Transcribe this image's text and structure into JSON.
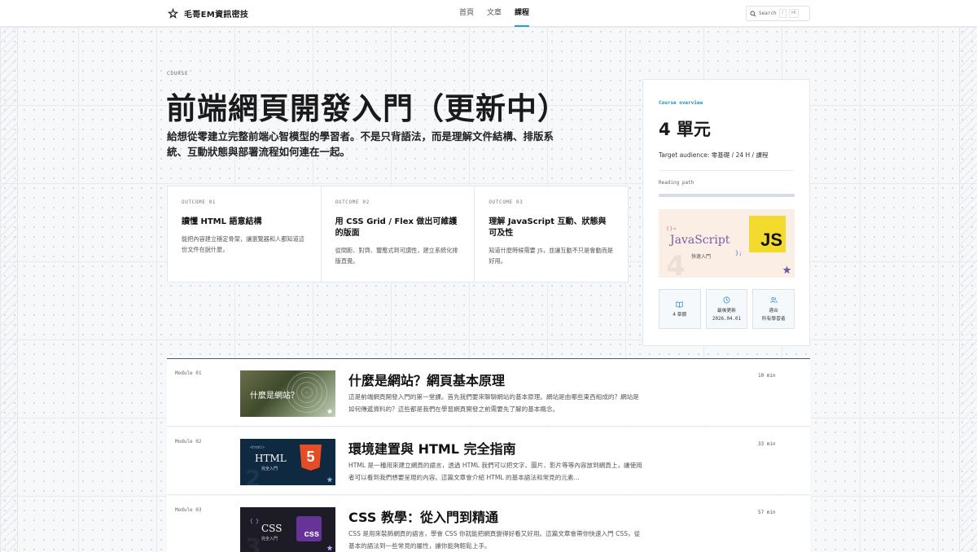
{
  "header": {
    "logo_text": "毛哥EM資訊密技",
    "nav": [
      {
        "label": "首頁",
        "active": false
      },
      {
        "label": "文章",
        "active": false
      },
      {
        "label": "課程",
        "active": true
      }
    ],
    "search_label": "Search",
    "search_kbd_1": "/",
    "search_kbd_2": "⌘K"
  },
  "hero": {
    "eyebrow": "COURSE",
    "title": "前端網頁開發入門（更新中）",
    "lead": "給想從零建立完整前端心智模型的學習者。不是只背語法，而是理解文件結構、排版系統、互動狀態與部署流程如何連在一起。",
    "outcomes": [
      {
        "label": "OUTCOME 01",
        "title": "讀懂 HTML 語意結構",
        "desc": "能把內容建立穩定骨架，讓瀏覽器和人都知道這份文件在說什麼。"
      },
      {
        "label": "OUTCOME 02",
        "title": "用 CSS Grid / Flex 做出可維護的版面",
        "desc": "從間距、對齊、響應式到可讀性，建立系統化排版直覺。"
      },
      {
        "label": "OUTCOME 03",
        "title": "理解 JavaScript 互動、狀態與可及性",
        "desc": "知道什麼時候需要 JS，並讓互動不只是會動而是好用。"
      }
    ]
  },
  "overview": {
    "eyebrow": "Course overview",
    "units": "4 單元",
    "audience": "Target audience: 零基礎 / 24 H / 課程",
    "reading_path": "Reading path",
    "thumb": {
      "code": "()⇒",
      "name": "JavaScript",
      "sub": "快速入門",
      "semi": "};",
      "num": "4",
      "logo": "JS"
    },
    "stats": [
      {
        "icon": "book-icon",
        "line1": "4 章節",
        "line2": ""
      },
      {
        "icon": "clock-icon",
        "line1": "最後更新",
        "line2": "2026.04.01"
      },
      {
        "icon": "users-icon",
        "line1": "適合",
        "line2": "所有學習者"
      }
    ]
  },
  "modules": [
    {
      "label": "Module 01",
      "title": "什麼是網站？網頁基本原理",
      "desc": "這是前端網頁開發入門的第一堂課。首先我們要來聊聊網站的基本原理。網站是由哪些東西組成的？網站是如何傳遞資料的？這些都是我們在學習網頁開發之前需要先了解的基本概念。",
      "time": "10 min",
      "thumb_caption": "什麼是網站？"
    },
    {
      "label": "Module 02",
      "title": "環境建置與 HTML 完全指南",
      "desc": "HTML 是一種用來建立網頁的語言，透過 HTML 我們可以把文字、圖片、影片等等內容放到網頁上，讓使用者可以看到我們想要呈現的內容。這篇文章會介紹 HTML 的基本語法和常見的元素...",
      "time": "33 min",
      "thumb_caption": "HTML",
      "thumb_sub": "完全入門",
      "thumb_code": "<html>",
      "thumb_num": "2",
      "thumb_logo": "5"
    },
    {
      "label": "Module 03",
      "title": "CSS 教學：從入門到精通",
      "desc": "CSS 是用來裝飾網頁的語言，學會 CSS 你就能把網頁變得好看又好用。這篇文章會帶你快速入門 CSS，從基本的語法到一些常見的屬性，讓你能夠輕鬆上手。",
      "time": "57 min",
      "thumb_caption": "CSS",
      "thumb_sub": "完全入門",
      "thumb_code": "{ }",
      "thumb_num": "3",
      "thumb_logo": "css"
    }
  ],
  "colors": {
    "accent": "#1aa3d4",
    "js_yellow": "#f2db2c",
    "html_orange": "#e44d26",
    "css_purple": "#663399"
  }
}
